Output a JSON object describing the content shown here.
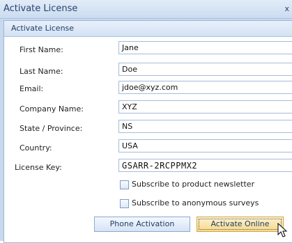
{
  "window": {
    "title": "Activate License",
    "close_glyph": "x"
  },
  "group": {
    "title": "Activate License"
  },
  "fields": [
    {
      "label": "First Name:",
      "value": "Jane"
    },
    {
      "label": "Last Name:",
      "value": "Doe"
    },
    {
      "label": "Email:",
      "value": "jdoe@xyz.com"
    },
    {
      "label": "Company Name:",
      "value": "XYZ"
    },
    {
      "label": "State / Province:",
      "value": "NS"
    },
    {
      "label": "Country:",
      "value": "USA"
    }
  ],
  "license_key": {
    "label": "License Key:",
    "value": "GSARR-2RCPPMX2"
  },
  "checkboxes": [
    {
      "label": "Subscribe to product newsletter",
      "checked": false
    },
    {
      "label": "Subscribe to anonymous surveys",
      "checked": false
    }
  ],
  "buttons": {
    "phone": "Phone Activation",
    "online": "Activate Online"
  },
  "icons": {
    "close": "close-icon",
    "cursor": "mouse-pointer-icon"
  },
  "colors": {
    "title_text": "#27456e",
    "panel_border": "#9cb5d6",
    "focus_button": "#f7d98a"
  }
}
